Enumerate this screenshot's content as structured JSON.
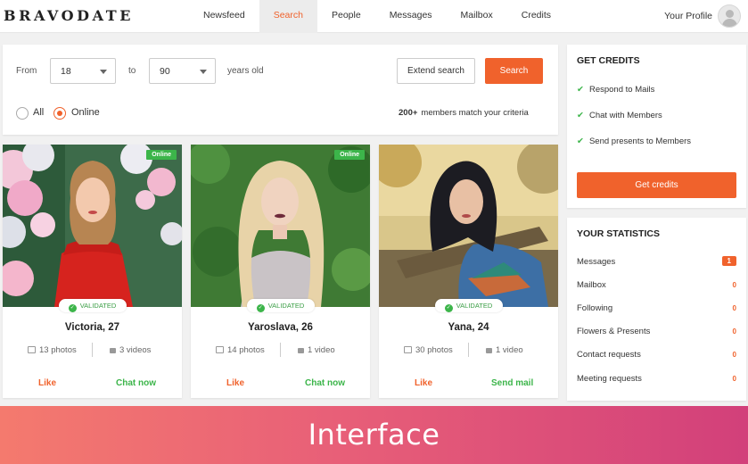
{
  "brand": "BRAVODATE",
  "nav": [
    {
      "label": "Newsfeed",
      "active": false
    },
    {
      "label": "Search",
      "active": true
    },
    {
      "label": "People",
      "active": false
    },
    {
      "label": "Messages",
      "active": false
    },
    {
      "label": "Mailbox",
      "active": false
    },
    {
      "label": "Credits",
      "active": false
    }
  ],
  "profile_label": "Your Profile",
  "search": {
    "from_label": "From",
    "from_value": "18",
    "to_label": "to",
    "to_value": "90",
    "suffix": "years old",
    "extend_button": "Extend search",
    "search_button": "Search",
    "radio_all": "All",
    "radio_online": "Online",
    "selected_radio": "Online",
    "match_count": "200+",
    "match_text": "members match your criteria"
  },
  "cards": [
    {
      "online_badge": "Online",
      "validated": "VALIDATED",
      "name": "Victoria, 27",
      "photos": "13 photos",
      "videos": "3 videos",
      "like": "Like",
      "action": "Chat now"
    },
    {
      "online_badge": "Online",
      "validated": "VALIDATED",
      "name": "Yaroslava, 26",
      "photos": "14 photos",
      "videos": "1 video",
      "like": "Like",
      "action": "Chat now"
    },
    {
      "online_badge": "",
      "validated": "VALIDATED",
      "name": "Yana, 24",
      "photos": "30 photos",
      "videos": "1 video",
      "like": "Like",
      "action": "Send mail"
    }
  ],
  "credits_panel": {
    "title": "GET CREDITS",
    "features": [
      "Respond to Mails",
      "Chat with Members",
      "Send presents to Members"
    ],
    "button": "Get credits"
  },
  "stats_panel": {
    "title": "YOUR STATISTICS",
    "rows": [
      {
        "label": "Messages",
        "value": "1"
      },
      {
        "label": "Mailbox",
        "value": "0"
      },
      {
        "label": "Following",
        "value": "0"
      },
      {
        "label": "Flowers & Presents",
        "value": "0"
      },
      {
        "label": "Contact requests",
        "value": "0"
      },
      {
        "label": "Meeting requests",
        "value": "0"
      }
    ]
  },
  "banner": "Interface",
  "colors": {
    "accent": "#f0622c",
    "success": "#3cb54a",
    "banner_start": "#f47a6e",
    "banner_end": "#d2407a"
  }
}
